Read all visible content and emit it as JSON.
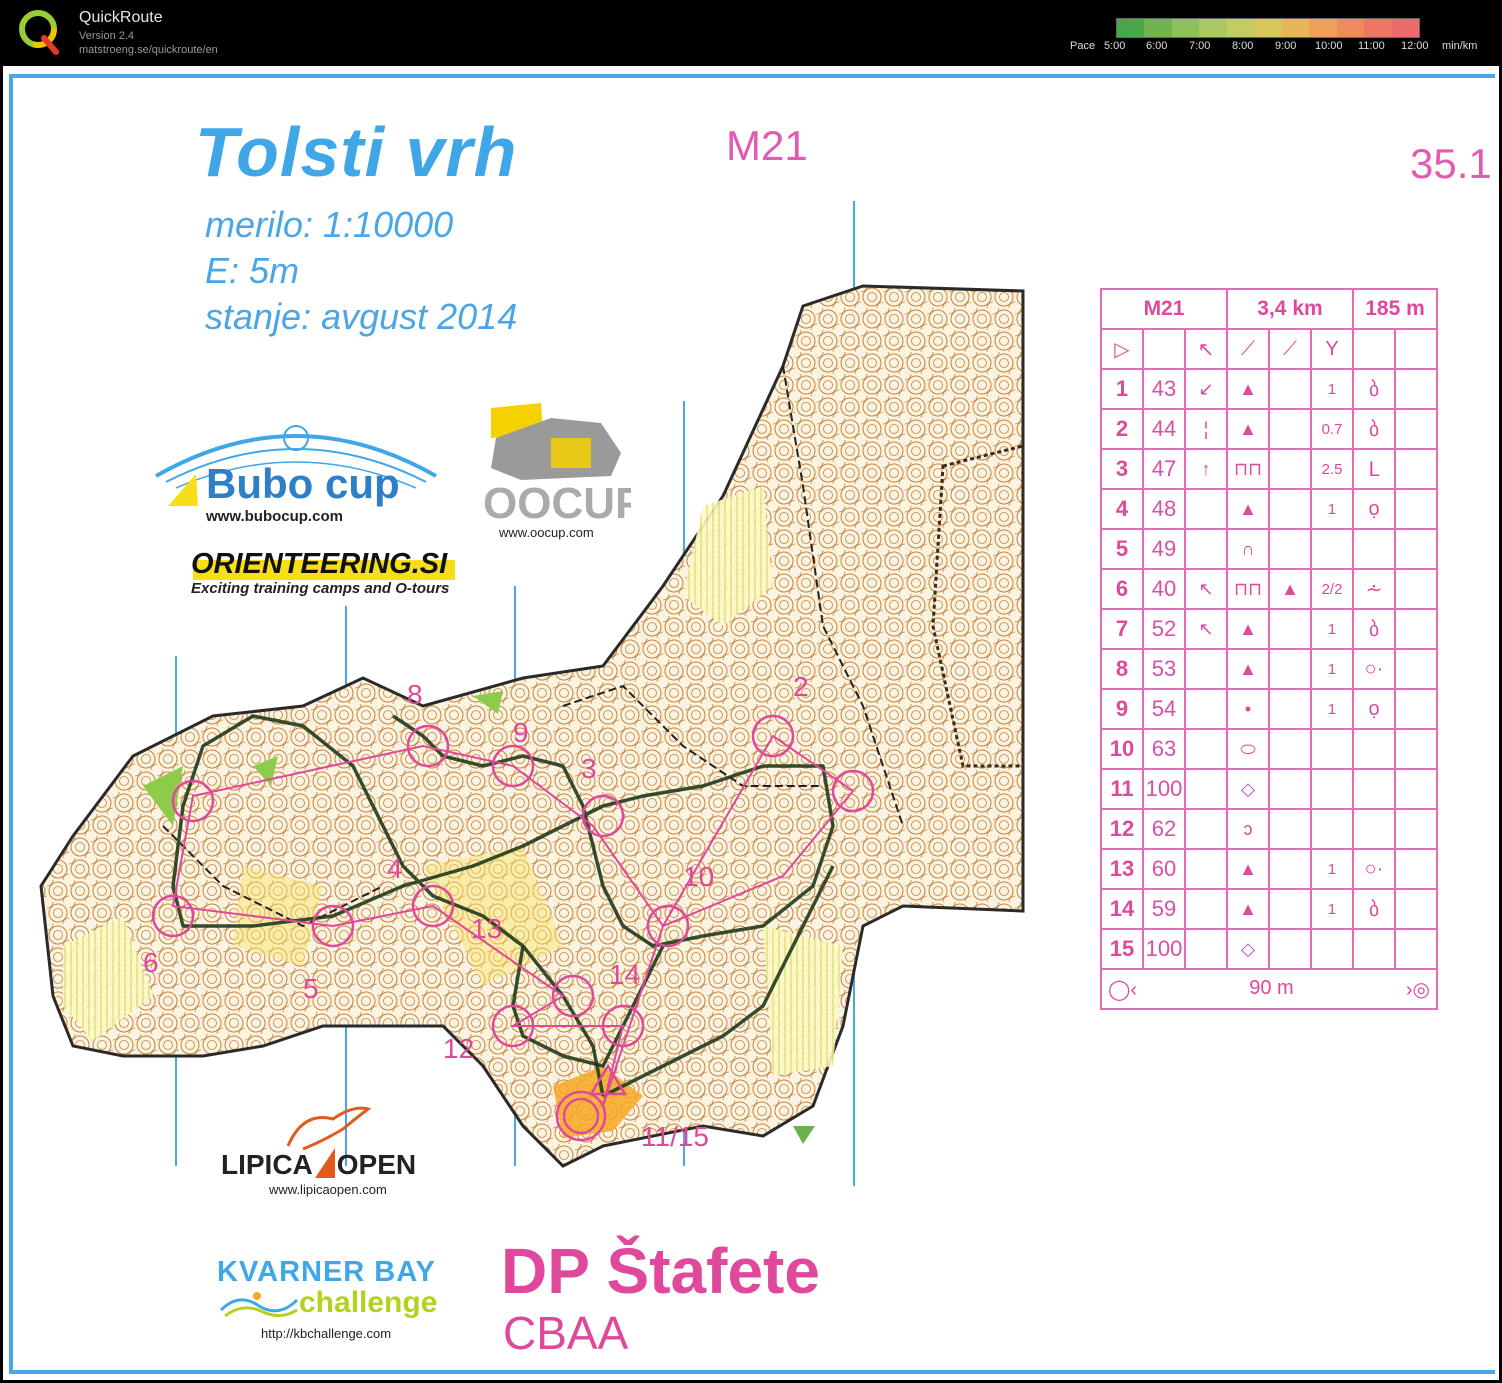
{
  "app": {
    "title": "QuickRoute",
    "version": "Version 2.4",
    "url": "matstroeng.se/quickroute/en"
  },
  "pace_legend": {
    "prefix": "Pace",
    "labels": [
      "5:00",
      "6:00",
      "7:00",
      "8:00",
      "9:00",
      "10:00",
      "11:00",
      "12:00"
    ],
    "unit": "min/km",
    "colors": [
      "#4aa64a",
      "#6fb24e",
      "#8cc05a",
      "#a9c862",
      "#c3cc62",
      "#d8c85c",
      "#e6b659",
      "#eea058",
      "#ef8a5c",
      "#ef7563",
      "#ec6a6a"
    ]
  },
  "map": {
    "title": "Tolsti vrh",
    "scale": "merilo: 1:10000",
    "equidistance": "E: 5m",
    "state": "stanje: avgust 2014",
    "category": "M21",
    "map_code": "35.1",
    "event": "DP Štafete",
    "subevent": "CBAA",
    "control_labels": [
      "2",
      "3",
      "4",
      "5",
      "6",
      "8",
      "9",
      "10",
      "12",
      "13",
      "14",
      "11/15"
    ],
    "colors": {
      "course": "#e0489c",
      "route": "#1f3a1c",
      "grid": "#4aa6e6"
    }
  },
  "sponsors": {
    "bubo_name": "Bubo cup",
    "bubo_url": "www.bubocup.com",
    "oocup_name": "OOCUP",
    "oocup_url": "www.oocup.com",
    "orienteering": "ORIENTEERING.SI",
    "orienteering_tag": "Exciting training camps and O-tours",
    "lipica": "LIPICA",
    "lipica_open": "OPEN",
    "lipica_url": "www.lipicaopen.com",
    "kvarner": "KVARNER BAY",
    "challenge": "challenge",
    "kb_url": "http://kbchallenge.com"
  },
  "description_sheet": {
    "category": "M21",
    "length": "3,4 km",
    "climb": "185 m",
    "finish_distance": "90 m",
    "rows": [
      {
        "n": "1",
        "code": "43",
        "dim": "1"
      },
      {
        "n": "2",
        "code": "44",
        "dim": "0.7"
      },
      {
        "n": "3",
        "code": "47",
        "dim": "2.5"
      },
      {
        "n": "4",
        "code": "48",
        "dim": "1"
      },
      {
        "n": "5",
        "code": "49",
        "dim": ""
      },
      {
        "n": "6",
        "code": "40",
        "dim": "2/2"
      },
      {
        "n": "7",
        "code": "52",
        "dim": "1"
      },
      {
        "n": "8",
        "code": "53",
        "dim": "1"
      },
      {
        "n": "9",
        "code": "54",
        "dim": "1"
      },
      {
        "n": "10",
        "code": "63",
        "dim": ""
      },
      {
        "n": "11",
        "code": "100",
        "dim": ""
      },
      {
        "n": "12",
        "code": "62",
        "dim": ""
      },
      {
        "n": "13",
        "code": "60",
        "dim": "1"
      },
      {
        "n": "14",
        "code": "59",
        "dim": "1"
      },
      {
        "n": "15",
        "code": "100",
        "dim": ""
      }
    ]
  }
}
